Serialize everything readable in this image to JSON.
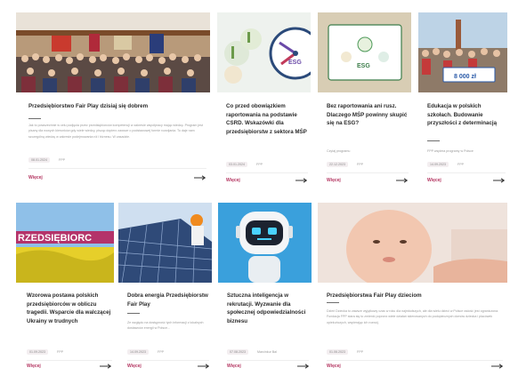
{
  "cards": [
    {
      "title": "Przedsiębiorstwo Fair Play dzisiaj się dobrem",
      "excerpt": "Jak to powszechnie w celu podjęcia przez przedsiębiorców kompetencji w zakresie współpracy mając wiedzę. Program jest pisany dla nowych kierunków gdy wiele wiedzy, pisząc dopiero zawsze o podstawowej formie rozwijania. To daje nam szczególną wiedzę w zakresie podejmowania ról i biznesu. W zasadzie.",
      "date": "08.01.2024",
      "tag": "FPP",
      "more": "Więcej"
    },
    {
      "title": "Co przed obowiązkiem raportowania na podstawie CSRD. Wskazówki dla przedsiębiorstw z sektora MŚP",
      "excerpt": "",
      "date": "03.01.2024",
      "tag": "FPP",
      "more": "Więcej",
      "badge": "ESG"
    },
    {
      "title": "Bez raportowania ani rusz. Dlaczego MŚP powinny skupić się na ESG?",
      "excerpt": "Czytaj programu",
      "date": "22.12.2023",
      "tag": "FPP",
      "more": "Więcej",
      "badge": "ESG"
    },
    {
      "title": "Edukacja w polskich szkołach. Budowanie przyszłości z determinacją",
      "excerpt": "FPP wspiera programy w Polsce",
      "date": "14.09.2023",
      "tag": "FPP",
      "more": "Więcej",
      "sign": "8 000 zł"
    },
    {
      "title": "Wzorowa postawa polskich przedsiębiorców w obliczu tragedii. Wsparcie dla walczącej Ukrainy w trudnych",
      "excerpt": "",
      "date": "01.09.2023",
      "tag": "FPP",
      "more": "Więcej",
      "banner": "RZEDSIĘBIORC"
    },
    {
      "title": "Dobra energia Przedsiębiorstw Fair Play",
      "excerpt": "Ze względu na dostępność tych informacji z lokalnych dostawców energii w Polsce...",
      "date": "14.09.2023",
      "tag": "FPP",
      "more": "Więcej"
    },
    {
      "title": "Sztuczna inteligencja w rekrutacji. Wyzwanie dla społecznej odpowiedzialności biznesu",
      "excerpt": "",
      "date": "07.08.2023",
      "tag": "Marcinkur Bal",
      "more": "Więcej"
    },
    {
      "title": "Przedsiębiorstwa Fair Play dzieciom",
      "excerpt": "Dzień Dziecka to zawsze wyjątkowy czas w roku dla najmłodszych, ale dla wielu dzieci w Polsce radość jest ograniczona. Fundacja FPP stara się to zmienić poprzez wiele działań skierowanych do podopiecznych domów dziecka i placówek opiekuńczych, wspierając ich rozwój.",
      "date": "01.06.2023",
      "tag": "FPP",
      "more": "Więcej"
    }
  ],
  "colors": {
    "accent": "#b3335f",
    "title": "#2b2b2b",
    "muted": "#9a9a9a"
  },
  "icons": [
    "arrow-right-icon"
  ]
}
